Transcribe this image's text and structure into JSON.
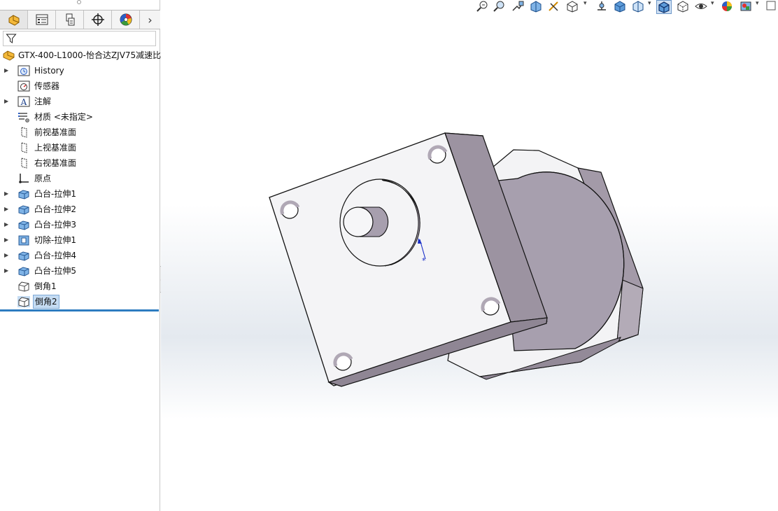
{
  "feature_tree": {
    "root": "GTX-400-L1000-怡合达ZJV75减速比",
    "items": [
      {
        "label": "History",
        "expandable": true,
        "icon": "history-icon"
      },
      {
        "label": "传感器",
        "expandable": false,
        "icon": "sensor-icon"
      },
      {
        "label": "注解",
        "expandable": true,
        "icon": "annotation-icon"
      },
      {
        "label": "材质 <未指定>",
        "expandable": false,
        "icon": "material-icon"
      },
      {
        "label": "前视基准面",
        "expandable": false,
        "icon": "plane-icon"
      },
      {
        "label": "上视基准面",
        "expandable": false,
        "icon": "plane-icon"
      },
      {
        "label": "右视基准面",
        "expandable": false,
        "icon": "plane-icon"
      },
      {
        "label": "原点",
        "expandable": false,
        "icon": "origin-icon"
      },
      {
        "label": "凸台-拉伸1",
        "expandable": true,
        "icon": "boss-extrude-icon"
      },
      {
        "label": "凸台-拉伸2",
        "expandable": true,
        "icon": "boss-extrude-icon"
      },
      {
        "label": "凸台-拉伸3",
        "expandable": true,
        "icon": "boss-extrude-icon"
      },
      {
        "label": "切除-拉伸1",
        "expandable": true,
        "icon": "cut-extrude-icon"
      },
      {
        "label": "凸台-拉伸4",
        "expandable": true,
        "icon": "boss-extrude-icon"
      },
      {
        "label": "凸台-拉伸5",
        "expandable": true,
        "icon": "boss-extrude-icon"
      },
      {
        "label": "倒角1",
        "expandable": false,
        "icon": "chamfer-icon"
      },
      {
        "label": "倒角2",
        "expandable": false,
        "icon": "chamfer-icon",
        "selected": true
      }
    ]
  },
  "manager_tabs": [
    "feature-manager-icon",
    "property-manager-icon",
    "configuration-manager-icon",
    "dimxpert-icon",
    "display-manager-icon"
  ],
  "colors": {
    "selection": "#c5dcf3",
    "rollback_bar": "#2d7cc0",
    "part_face": "#f2f2f4",
    "part_side": "#9e95a3",
    "part_cylinder": "#a79fae"
  }
}
